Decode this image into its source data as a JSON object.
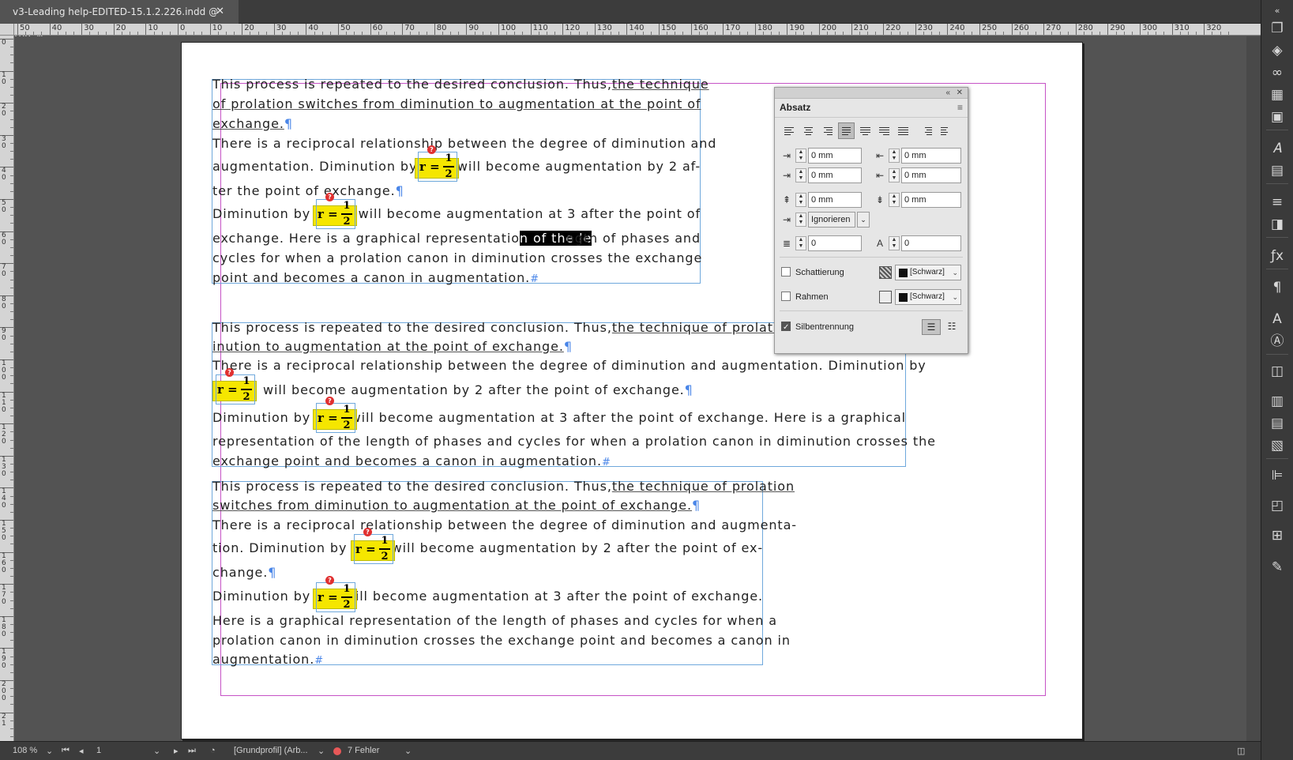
{
  "document": {
    "tab_title": "v3-Leading help-EDITED-15.1.2.226.indd @ 108 %",
    "close_label": "✕"
  },
  "ruler": {
    "h_labels": [
      "50",
      "40",
      "30",
      "20",
      "10",
      "0",
      "10",
      "20",
      "30",
      "40",
      "50",
      "60",
      "70",
      "80",
      "90",
      "100",
      "110",
      "120",
      "130",
      "140",
      "150",
      "160",
      "170",
      "180",
      "190",
      "200",
      "210",
      "220",
      "230",
      "240",
      "250",
      "260",
      "270",
      "280",
      "290",
      "300",
      "310",
      "320"
    ],
    "v_labels": [
      "0",
      "1\n0",
      "2\n0",
      "3\n0",
      "4\n0",
      "5\n0",
      "6\n0",
      "7\n0",
      "8\n0",
      "9\n0",
      "1\n0\n0",
      "1\n1\n0",
      "1\n2\n0",
      "1\n3\n0",
      "1\n4\n0",
      "1\n5\n0",
      "1\n6\n0",
      "1\n7\n0",
      "1\n8\n0",
      "1\n9\n0",
      "2\n0\n0",
      "2\n1"
    ]
  },
  "frame1": {
    "l1a": "This process is repeated to the desired conclusion. Thus,",
    "l1b": "the technique",
    "l2": "of prolation switches from diminution to augmentation at the point of",
    "l3": "exchange.",
    "l4": "There is a reciprocal relationship between the degree of diminution and",
    "l5a": "augmentation. Diminution by",
    "l5b": "will become augmentation by 2 af-",
    "l6": "ter the point of exchange.",
    "l7a": "Diminution by",
    "l7b": "will become augmentation at 3 after the point of",
    "l8a": "exchange. Here is a graphical representatio",
    "l8sel": "n of the le",
    "l8b": "ngth of phases and",
    "l9": "cycles for when a prolation canon in diminution crosses the exchange",
    "l10": "point and becomes a canon in augmentation."
  },
  "frame2": {
    "l1a": "This process is repeated to the desired conclusion. Thus,",
    "l1b": "the technique of prolation switches from dim-",
    "l2": "inution to augmentation at the point of exchange.",
    "l3": "There is a reciprocal relationship between the degree of diminution and augmentation. Diminution by",
    "l4": "will become augmentation by 2 after the point of exchange.",
    "l5a": "Diminution by",
    "l5b": "will become augmentation at 3 after the point of exchange. Here is a graphical",
    "l6": "representation of the length of phases and cycles for when a prolation canon in diminution crosses the",
    "l7": "exchange point and becomes a canon in augmentation."
  },
  "frame3": {
    "l1a": "This process is repeated to the desired conclusion. Thus,",
    "l1b": "the technique of prolation",
    "l2": "switches from diminution to augmentation at the point of exchange.",
    "l3": "There is a reciprocal relationship between the degree of diminution and augmenta-",
    "l4a": "tion. Diminution by",
    "l4b": "will become augmentation by 2 after the point of ex-",
    "l5": "change.",
    "l6a": "Diminution by",
    "l6b": "will become augmentation at 3 after the point of exchange.",
    "l7": "Here is a graphical representation of the length of phases and cycles for when a",
    "l8": "prolation canon in diminution crosses the exchange point and becomes a canon in",
    "l9": "augmentation."
  },
  "marks": {
    "pilcrow": "¶",
    "hash": "#"
  },
  "formula": {
    "lhs": "r =",
    "num": "1",
    "den": "2",
    "error_badge": "?"
  },
  "panel": {
    "collapse_icon": "«",
    "close_icon": "✕",
    "tab": "Absatz",
    "menu_icon": "≡",
    "indent_left": "0 mm",
    "indent_right": "0 mm",
    "first_line": "0 mm",
    "last_line": "0 mm",
    "space_before": "0 mm",
    "space_after": "0 mm",
    "align_to_grid": "Ignorieren",
    "drop_cap_lines": "0",
    "drop_cap_chars": "0",
    "shading_label": "Schattierung",
    "shading_color": "[Schwarz]",
    "border_label": "Rahmen",
    "border_color": "[Schwarz]",
    "hyphenation_label": "Silbentrennung"
  },
  "status": {
    "zoom": "108 %",
    "page": "1",
    "profile": "[Grundprofil] (Arb...",
    "errors": "7 Fehler"
  },
  "colors": {
    "selection": "#000000",
    "formula_bg": "#f5e600",
    "error": "#e03030",
    "frame": "#6fa8dc",
    "margin": "#c653c6"
  }
}
